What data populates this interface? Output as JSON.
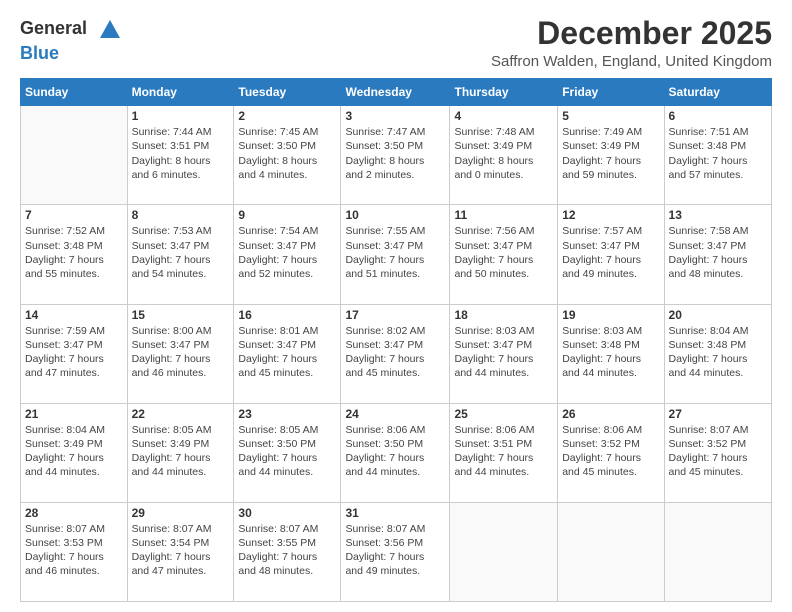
{
  "header": {
    "logo_general": "General",
    "logo_blue": "Blue",
    "month_title": "December 2025",
    "subtitle": "Saffron Walden, England, United Kingdom"
  },
  "days_of_week": [
    "Sunday",
    "Monday",
    "Tuesday",
    "Wednesday",
    "Thursday",
    "Friday",
    "Saturday"
  ],
  "weeks": [
    [
      {
        "day": "",
        "info": ""
      },
      {
        "day": "1",
        "info": "Sunrise: 7:44 AM\nSunset: 3:51 PM\nDaylight: 8 hours\nand 6 minutes."
      },
      {
        "day": "2",
        "info": "Sunrise: 7:45 AM\nSunset: 3:50 PM\nDaylight: 8 hours\nand 4 minutes."
      },
      {
        "day": "3",
        "info": "Sunrise: 7:47 AM\nSunset: 3:50 PM\nDaylight: 8 hours\nand 2 minutes."
      },
      {
        "day": "4",
        "info": "Sunrise: 7:48 AM\nSunset: 3:49 PM\nDaylight: 8 hours\nand 0 minutes."
      },
      {
        "day": "5",
        "info": "Sunrise: 7:49 AM\nSunset: 3:49 PM\nDaylight: 7 hours\nand 59 minutes."
      },
      {
        "day": "6",
        "info": "Sunrise: 7:51 AM\nSunset: 3:48 PM\nDaylight: 7 hours\nand 57 minutes."
      }
    ],
    [
      {
        "day": "7",
        "info": "Sunrise: 7:52 AM\nSunset: 3:48 PM\nDaylight: 7 hours\nand 55 minutes."
      },
      {
        "day": "8",
        "info": "Sunrise: 7:53 AM\nSunset: 3:47 PM\nDaylight: 7 hours\nand 54 minutes."
      },
      {
        "day": "9",
        "info": "Sunrise: 7:54 AM\nSunset: 3:47 PM\nDaylight: 7 hours\nand 52 minutes."
      },
      {
        "day": "10",
        "info": "Sunrise: 7:55 AM\nSunset: 3:47 PM\nDaylight: 7 hours\nand 51 minutes."
      },
      {
        "day": "11",
        "info": "Sunrise: 7:56 AM\nSunset: 3:47 PM\nDaylight: 7 hours\nand 50 minutes."
      },
      {
        "day": "12",
        "info": "Sunrise: 7:57 AM\nSunset: 3:47 PM\nDaylight: 7 hours\nand 49 minutes."
      },
      {
        "day": "13",
        "info": "Sunrise: 7:58 AM\nSunset: 3:47 PM\nDaylight: 7 hours\nand 48 minutes."
      }
    ],
    [
      {
        "day": "14",
        "info": "Sunrise: 7:59 AM\nSunset: 3:47 PM\nDaylight: 7 hours\nand 47 minutes."
      },
      {
        "day": "15",
        "info": "Sunrise: 8:00 AM\nSunset: 3:47 PM\nDaylight: 7 hours\nand 46 minutes."
      },
      {
        "day": "16",
        "info": "Sunrise: 8:01 AM\nSunset: 3:47 PM\nDaylight: 7 hours\nand 45 minutes."
      },
      {
        "day": "17",
        "info": "Sunrise: 8:02 AM\nSunset: 3:47 PM\nDaylight: 7 hours\nand 45 minutes."
      },
      {
        "day": "18",
        "info": "Sunrise: 8:03 AM\nSunset: 3:47 PM\nDaylight: 7 hours\nand 44 minutes."
      },
      {
        "day": "19",
        "info": "Sunrise: 8:03 AM\nSunset: 3:48 PM\nDaylight: 7 hours\nand 44 minutes."
      },
      {
        "day": "20",
        "info": "Sunrise: 8:04 AM\nSunset: 3:48 PM\nDaylight: 7 hours\nand 44 minutes."
      }
    ],
    [
      {
        "day": "21",
        "info": "Sunrise: 8:04 AM\nSunset: 3:49 PM\nDaylight: 7 hours\nand 44 minutes."
      },
      {
        "day": "22",
        "info": "Sunrise: 8:05 AM\nSunset: 3:49 PM\nDaylight: 7 hours\nand 44 minutes."
      },
      {
        "day": "23",
        "info": "Sunrise: 8:05 AM\nSunset: 3:50 PM\nDaylight: 7 hours\nand 44 minutes."
      },
      {
        "day": "24",
        "info": "Sunrise: 8:06 AM\nSunset: 3:50 PM\nDaylight: 7 hours\nand 44 minutes."
      },
      {
        "day": "25",
        "info": "Sunrise: 8:06 AM\nSunset: 3:51 PM\nDaylight: 7 hours\nand 44 minutes."
      },
      {
        "day": "26",
        "info": "Sunrise: 8:06 AM\nSunset: 3:52 PM\nDaylight: 7 hours\nand 45 minutes."
      },
      {
        "day": "27",
        "info": "Sunrise: 8:07 AM\nSunset: 3:52 PM\nDaylight: 7 hours\nand 45 minutes."
      }
    ],
    [
      {
        "day": "28",
        "info": "Sunrise: 8:07 AM\nSunset: 3:53 PM\nDaylight: 7 hours\nand 46 minutes."
      },
      {
        "day": "29",
        "info": "Sunrise: 8:07 AM\nSunset: 3:54 PM\nDaylight: 7 hours\nand 47 minutes."
      },
      {
        "day": "30",
        "info": "Sunrise: 8:07 AM\nSunset: 3:55 PM\nDaylight: 7 hours\nand 48 minutes."
      },
      {
        "day": "31",
        "info": "Sunrise: 8:07 AM\nSunset: 3:56 PM\nDaylight: 7 hours\nand 49 minutes."
      },
      {
        "day": "",
        "info": ""
      },
      {
        "day": "",
        "info": ""
      },
      {
        "day": "",
        "info": ""
      }
    ]
  ]
}
